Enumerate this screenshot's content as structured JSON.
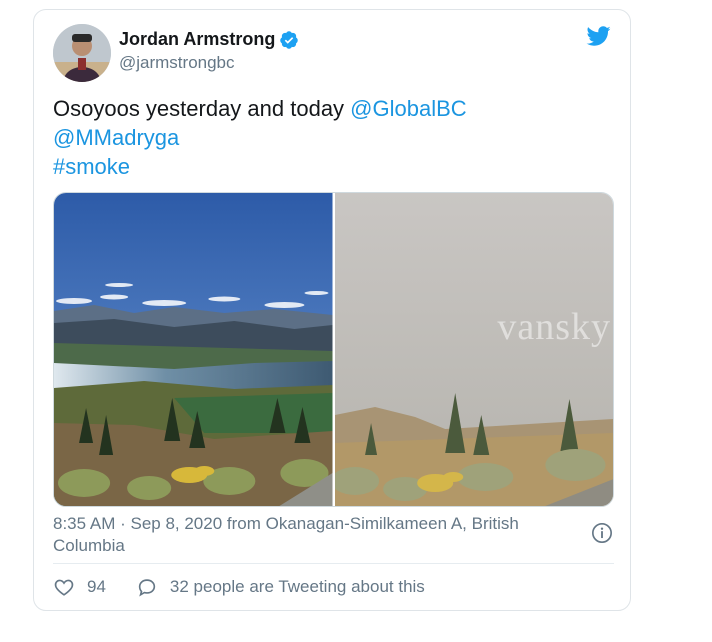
{
  "tweet": {
    "author": {
      "name": "Jordan Armstrong",
      "handle": "@jarmstrongbc",
      "verified": true
    },
    "text_lines": [
      [
        {
          "type": "text",
          "value": "Osoyoos yesterday and today "
        },
        {
          "type": "mention",
          "value": "@GlobalBC"
        }
      ],
      [
        {
          "type": "mention",
          "value": "@MMadryga"
        }
      ],
      [
        {
          "type": "hashtag",
          "value": "#smoke"
        }
      ]
    ],
    "media": {
      "left_image": "clear-sky-lake-valley-photo",
      "right_image": "smoky-haze-valley-photo",
      "watermark": "vansky"
    },
    "timestamp": "8:35 AM · Sep 8, 2020 from Okanagan-Similkameen A, British Columbia",
    "likes": "94",
    "tweeting_text": "32 people are Tweeting about this"
  },
  "colors": {
    "link": "#1b95e0",
    "muted": "#657786",
    "verified": "#1da1f2",
    "twitter_bird": "#1da1f2"
  }
}
